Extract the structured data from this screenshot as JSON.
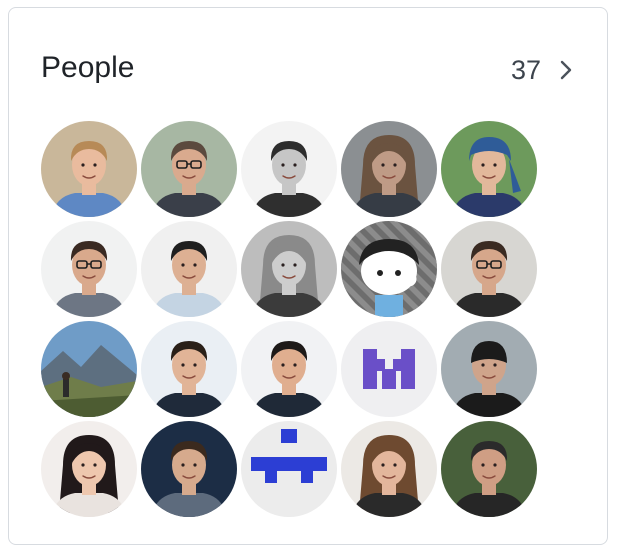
{
  "panel": {
    "title": "People",
    "count": "37",
    "chevron_icon": "chevron-right-icon"
  },
  "people": [
    {
      "bg": "#c9b79a",
      "skin": "#e9bb9e",
      "hair": "#b78a57",
      "shirt": "#5e88c4"
    },
    {
      "bg": "#a7b7a3",
      "skin": "#d9aa8e",
      "hair": "#5b4a3e",
      "shirt": "#3a3f49",
      "glasses": true
    },
    {
      "bg": "#f3f3f3",
      "skin": "#c6c6c6",
      "hair": "#2d2d2d",
      "shirt": "#2f2f2f",
      "gray": true
    },
    {
      "bg": "#8b8f92",
      "skin": "#bf9b86",
      "hair": "#6b5340",
      "shirt": "#363c45",
      "longhair": true
    },
    {
      "bg": "#6d9a5c",
      "skin": "#e2b89b",
      "hair": "#2f5c98",
      "shirt": "#2b3a6a",
      "wrap": true
    },
    {
      "bg": "#f1f2f2",
      "skin": "#d9a98c",
      "hair": "#3a2a22",
      "shirt": "#6d7684",
      "glasses": true
    },
    {
      "bg": "#f0f0f0",
      "skin": "#ddb093",
      "hair": "#1f1f1f",
      "shirt": "#c4d4e3"
    },
    {
      "bg": "#bdbdbd",
      "skin": "#cdcdcd",
      "hair": "#8a8a8a",
      "shirt": "#3b3b3b",
      "gray": true,
      "longhair": true
    },
    {
      "bg": "#6d6d6d",
      "cartoon": true
    },
    {
      "bg": "#d7d6d2",
      "skin": "#d6a78b",
      "hair": "#3a2b22",
      "shirt": "#2a2a2a",
      "glasses": true
    },
    {
      "landscape": true
    },
    {
      "bg": "#eaeff4",
      "skin": "#e1b497",
      "hair": "#2a2018",
      "shirt": "#1f2a3a"
    },
    {
      "bg": "#f1f2f4",
      "skin": "#e0ae8f",
      "hair": "#1e1a18",
      "shirt": "#1f2937"
    },
    {
      "bg": "#efeff1",
      "logo": "m"
    },
    {
      "bg": "#a2acb2",
      "skin": "#cfa48b",
      "hair": "#1b1b1b",
      "shirt": "#1b1b1b",
      "cap": true
    },
    {
      "bg": "#f2eeec",
      "skin": "#eec7ae",
      "hair": "#21191a",
      "shirt": "#e9e3df",
      "longhair": true
    },
    {
      "bg": "#1c2d45",
      "skin": "#d6aa8d",
      "hair": "#3b2a1e",
      "shirt": "#5d6b7d"
    },
    {
      "bg": "#ececec",
      "logo": "t"
    },
    {
      "bg": "#ece9e5",
      "skin": "#e3b69c",
      "hair": "#6e4a30",
      "shirt": "#2a2a2a",
      "longhair": true
    },
    {
      "bg": "#48603b",
      "skin": "#cf9e84",
      "hair": "#2b2b2b",
      "shirt": "#262626"
    }
  ]
}
